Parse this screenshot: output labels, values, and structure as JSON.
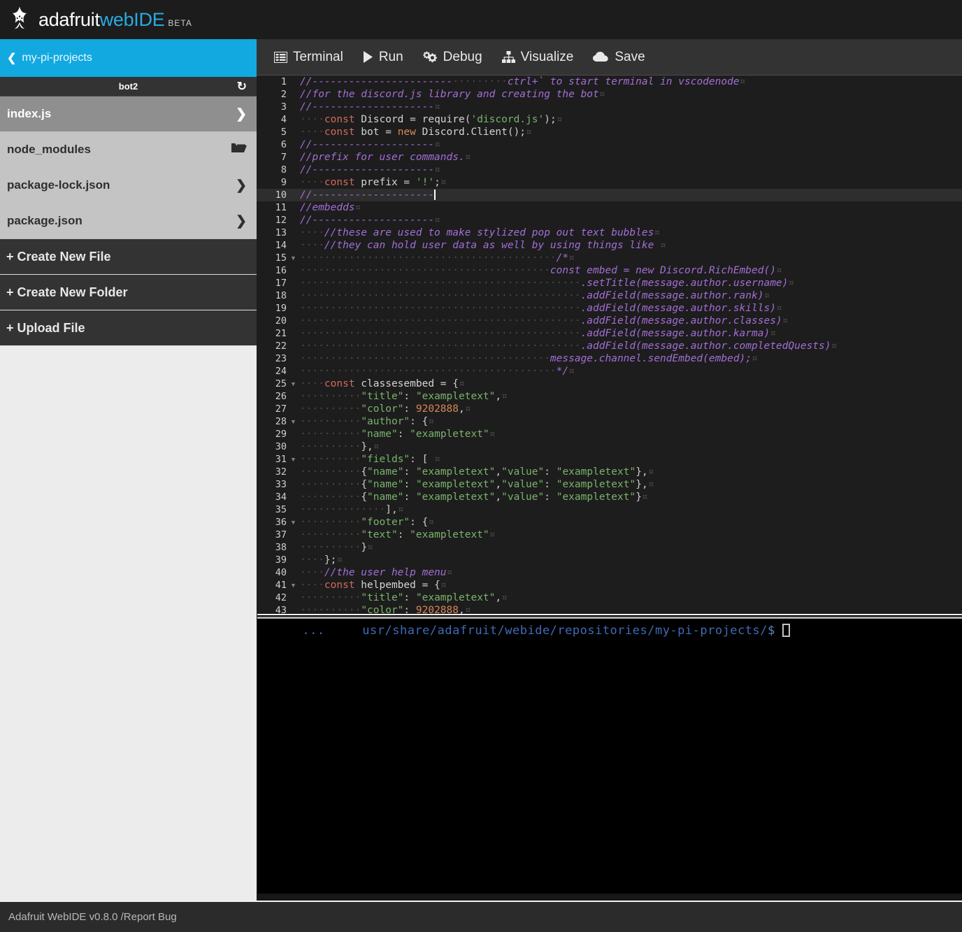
{
  "app": {
    "brand_first": "adafruit",
    "brand_second": "webIDE",
    "brand_badge": "BETA",
    "logo_icon": "adafruit-star-icon"
  },
  "sidebar": {
    "project": {
      "label": "my-pi-projects",
      "back_icon": "chevron-left-icon"
    },
    "folder": {
      "name": "bot2",
      "refresh_icon": "refresh-icon"
    },
    "files": [
      {
        "name": "index.js",
        "icon": "chevron-right-icon",
        "selected": true
      },
      {
        "name": "node_modules",
        "icon": "folder-icon",
        "selected": false
      },
      {
        "name": "package-lock.json",
        "icon": "chevron-right-icon",
        "selected": false
      },
      {
        "name": "package.json",
        "icon": "chevron-right-icon",
        "selected": false
      }
    ],
    "actions": [
      {
        "label": "+ Create New File"
      },
      {
        "label": "+ Create New Folder"
      },
      {
        "label": "+ Upload File"
      }
    ]
  },
  "toolbar": {
    "buttons": [
      {
        "label": "Terminal",
        "icon": "terminal-list-icon"
      },
      {
        "label": "Run",
        "icon": "play-icon"
      },
      {
        "label": "Debug",
        "icon": "gears-icon"
      },
      {
        "label": "Visualize",
        "icon": "sitemap-icon"
      },
      {
        "label": "Save",
        "icon": "cloud-icon"
      }
    ]
  },
  "editor": {
    "active_line": 10,
    "lines": [
      {
        "n": 1,
        "fold": false,
        "tokens": [
          {
            "t": "com",
            "v": "//-----------------------"
          },
          {
            "t": "ws",
            "v": "·········"
          },
          {
            "t": "com",
            "v": "ctrl+` to start terminal in vscodenode"
          },
          {
            "t": "eol",
            "v": "¤"
          }
        ]
      },
      {
        "n": 2,
        "fold": false,
        "tokens": [
          {
            "t": "com",
            "v": "//for the discord.js library and creating the bot"
          },
          {
            "t": "eol",
            "v": "¤"
          }
        ]
      },
      {
        "n": 3,
        "fold": false,
        "tokens": [
          {
            "t": "com",
            "v": "//--------------------"
          },
          {
            "t": "eol",
            "v": "¤"
          }
        ]
      },
      {
        "n": 4,
        "fold": false,
        "tokens": [
          {
            "t": "ws",
            "v": "····"
          },
          {
            "t": "kw",
            "v": "const"
          },
          {
            "t": "id",
            "v": " Discord "
          },
          {
            "t": "pun",
            "v": "="
          },
          {
            "t": "id",
            "v": " require"
          },
          {
            "t": "pun",
            "v": "("
          },
          {
            "t": "str",
            "v": "'discord.js'"
          },
          {
            "t": "pun",
            "v": ");"
          },
          {
            "t": "eol",
            "v": "¤"
          }
        ]
      },
      {
        "n": 5,
        "fold": false,
        "tokens": [
          {
            "t": "ws",
            "v": "····"
          },
          {
            "t": "kw",
            "v": "const"
          },
          {
            "t": "id",
            "v": " bot "
          },
          {
            "t": "pun",
            "v": "="
          },
          {
            "t": "kw2",
            "v": " new"
          },
          {
            "t": "id",
            "v": " Discord.Client"
          },
          {
            "t": "pun",
            "v": "();"
          },
          {
            "t": "eol",
            "v": "¤"
          }
        ]
      },
      {
        "n": 6,
        "fold": false,
        "tokens": [
          {
            "t": "com",
            "v": "//--------------------"
          },
          {
            "t": "eol",
            "v": "¤"
          }
        ]
      },
      {
        "n": 7,
        "fold": false,
        "tokens": [
          {
            "t": "com",
            "v": "//prefix for user commands."
          },
          {
            "t": "eol",
            "v": "¤"
          }
        ]
      },
      {
        "n": 8,
        "fold": false,
        "tokens": [
          {
            "t": "com",
            "v": "//--------------------"
          },
          {
            "t": "eol",
            "v": "¤"
          }
        ]
      },
      {
        "n": 9,
        "fold": false,
        "tokens": [
          {
            "t": "ws",
            "v": "····"
          },
          {
            "t": "kw",
            "v": "const"
          },
          {
            "t": "id",
            "v": " prefix "
          },
          {
            "t": "pun",
            "v": "="
          },
          {
            "t": "str",
            "v": " '!'"
          },
          {
            "t": "pun",
            "v": ";"
          },
          {
            "t": "eol",
            "v": "¤"
          }
        ]
      },
      {
        "n": 10,
        "fold": false,
        "tokens": [
          {
            "t": "com",
            "v": "//--------------------"
          },
          {
            "t": "caret",
            "v": ""
          }
        ]
      },
      {
        "n": 11,
        "fold": false,
        "tokens": [
          {
            "t": "com",
            "v": "//embedds"
          },
          {
            "t": "eol",
            "v": "¤"
          }
        ]
      },
      {
        "n": 12,
        "fold": false,
        "tokens": [
          {
            "t": "com",
            "v": "//--------------------"
          },
          {
            "t": "eol",
            "v": "¤"
          }
        ]
      },
      {
        "n": 13,
        "fold": false,
        "tokens": [
          {
            "t": "ws",
            "v": "····"
          },
          {
            "t": "com",
            "v": "//these are used to make stylized pop out text bubbles"
          },
          {
            "t": "eol",
            "v": "¤"
          }
        ]
      },
      {
        "n": 14,
        "fold": false,
        "tokens": [
          {
            "t": "ws",
            "v": "····"
          },
          {
            "t": "com",
            "v": "//they can hold user data as well by using things like "
          },
          {
            "t": "eol",
            "v": "¤"
          }
        ]
      },
      {
        "n": 15,
        "fold": true,
        "tokens": [
          {
            "t": "ws",
            "v": "··········································"
          },
          {
            "t": "com",
            "v": "/*"
          },
          {
            "t": "eol",
            "v": "¤"
          }
        ]
      },
      {
        "n": 16,
        "fold": false,
        "tokens": [
          {
            "t": "ws",
            "v": "·········································"
          },
          {
            "t": "com",
            "v": "const embed = new Discord.RichEmbed()"
          },
          {
            "t": "eol",
            "v": "¤"
          }
        ]
      },
      {
        "n": 17,
        "fold": false,
        "tokens": [
          {
            "t": "ws",
            "v": "··············································"
          },
          {
            "t": "com",
            "v": ".setTitle(message.author.username)"
          },
          {
            "t": "eol",
            "v": "¤"
          }
        ]
      },
      {
        "n": 18,
        "fold": false,
        "tokens": [
          {
            "t": "ws",
            "v": "··············································"
          },
          {
            "t": "com",
            "v": ".addField(message.author.rank)"
          },
          {
            "t": "eol",
            "v": "¤"
          }
        ]
      },
      {
        "n": 19,
        "fold": false,
        "tokens": [
          {
            "t": "ws",
            "v": "··············································"
          },
          {
            "t": "com",
            "v": ".addField(message.author.skills)"
          },
          {
            "t": "eol",
            "v": "¤"
          }
        ]
      },
      {
        "n": 20,
        "fold": false,
        "tokens": [
          {
            "t": "ws",
            "v": "··············································"
          },
          {
            "t": "com",
            "v": ".addField(message.author.classes)"
          },
          {
            "t": "eol",
            "v": "¤"
          }
        ]
      },
      {
        "n": 21,
        "fold": false,
        "tokens": [
          {
            "t": "ws",
            "v": "··············································"
          },
          {
            "t": "com",
            "v": ".addField(message.author.karma)"
          },
          {
            "t": "eol",
            "v": "¤"
          }
        ]
      },
      {
        "n": 22,
        "fold": false,
        "tokens": [
          {
            "t": "ws",
            "v": "··············································"
          },
          {
            "t": "com",
            "v": ".addField(message.author.completedQuests)"
          },
          {
            "t": "eol",
            "v": "¤"
          }
        ]
      },
      {
        "n": 23,
        "fold": false,
        "tokens": [
          {
            "t": "ws",
            "v": "·········································"
          },
          {
            "t": "com",
            "v": "message.channel.sendEmbed(embed);"
          },
          {
            "t": "eol",
            "v": "¤"
          }
        ]
      },
      {
        "n": 24,
        "fold": false,
        "tokens": [
          {
            "t": "ws",
            "v": "··········································"
          },
          {
            "t": "com",
            "v": "*/"
          },
          {
            "t": "eol",
            "v": "¤"
          }
        ]
      },
      {
        "n": 25,
        "fold": true,
        "tokens": [
          {
            "t": "ws",
            "v": "····"
          },
          {
            "t": "kw",
            "v": "const"
          },
          {
            "t": "id",
            "v": " classesembed "
          },
          {
            "t": "pun",
            "v": "= {"
          },
          {
            "t": "eol",
            "v": "¤"
          }
        ]
      },
      {
        "n": 26,
        "fold": false,
        "tokens": [
          {
            "t": "ws",
            "v": "··········"
          },
          {
            "t": "str",
            "v": "\"title\""
          },
          {
            "t": "pun",
            "v": ": "
          },
          {
            "t": "str",
            "v": "\"exampletext\""
          },
          {
            "t": "pun",
            "v": ","
          },
          {
            "t": "eol",
            "v": "¤"
          }
        ]
      },
      {
        "n": 27,
        "fold": false,
        "tokens": [
          {
            "t": "ws",
            "v": "··········"
          },
          {
            "t": "str",
            "v": "\"color\""
          },
          {
            "t": "pun",
            "v": ": "
          },
          {
            "t": "num",
            "v": "9202888"
          },
          {
            "t": "pun",
            "v": ","
          },
          {
            "t": "eol",
            "v": "¤"
          }
        ]
      },
      {
        "n": 28,
        "fold": true,
        "tokens": [
          {
            "t": "ws",
            "v": "··········"
          },
          {
            "t": "str",
            "v": "\"author\""
          },
          {
            "t": "pun",
            "v": ": {"
          },
          {
            "t": "eol",
            "v": "¤"
          }
        ]
      },
      {
        "n": 29,
        "fold": false,
        "tokens": [
          {
            "t": "ws",
            "v": "··········"
          },
          {
            "t": "str",
            "v": "\"name\""
          },
          {
            "t": "pun",
            "v": ": "
          },
          {
            "t": "str",
            "v": "\"exampletext\""
          },
          {
            "t": "eol",
            "v": "¤"
          }
        ]
      },
      {
        "n": 30,
        "fold": false,
        "tokens": [
          {
            "t": "ws",
            "v": "··········"
          },
          {
            "t": "pun",
            "v": "},"
          },
          {
            "t": "eol",
            "v": "¤"
          }
        ]
      },
      {
        "n": 31,
        "fold": true,
        "tokens": [
          {
            "t": "ws",
            "v": "··········"
          },
          {
            "t": "str",
            "v": "\"fields\""
          },
          {
            "t": "pun",
            "v": ": ["
          },
          {
            "t": "eol",
            "v": " ¤"
          }
        ]
      },
      {
        "n": 32,
        "fold": false,
        "tokens": [
          {
            "t": "ws",
            "v": "··········"
          },
          {
            "t": "pun",
            "v": "{"
          },
          {
            "t": "str",
            "v": "\"name\""
          },
          {
            "t": "pun",
            "v": ": "
          },
          {
            "t": "str",
            "v": "\"exampletext\""
          },
          {
            "t": "pun",
            "v": ","
          },
          {
            "t": "str",
            "v": "\"value\""
          },
          {
            "t": "pun",
            "v": ": "
          },
          {
            "t": "str",
            "v": "\"exampletext\""
          },
          {
            "t": "pun",
            "v": "},"
          },
          {
            "t": "eol",
            "v": "¤"
          }
        ]
      },
      {
        "n": 33,
        "fold": false,
        "tokens": [
          {
            "t": "ws",
            "v": "··········"
          },
          {
            "t": "pun",
            "v": "{"
          },
          {
            "t": "str",
            "v": "\"name\""
          },
          {
            "t": "pun",
            "v": ": "
          },
          {
            "t": "str",
            "v": "\"exampletext\""
          },
          {
            "t": "pun",
            "v": ","
          },
          {
            "t": "str",
            "v": "\"value\""
          },
          {
            "t": "pun",
            "v": ": "
          },
          {
            "t": "str",
            "v": "\"exampletext\""
          },
          {
            "t": "pun",
            "v": "},"
          },
          {
            "t": "eol",
            "v": "¤"
          }
        ]
      },
      {
        "n": 34,
        "fold": false,
        "tokens": [
          {
            "t": "ws",
            "v": "··········"
          },
          {
            "t": "pun",
            "v": "{"
          },
          {
            "t": "str",
            "v": "\"name\""
          },
          {
            "t": "pun",
            "v": ": "
          },
          {
            "t": "str",
            "v": "\"exampletext\""
          },
          {
            "t": "pun",
            "v": ","
          },
          {
            "t": "str",
            "v": "\"value\""
          },
          {
            "t": "pun",
            "v": ": "
          },
          {
            "t": "str",
            "v": "\"exampletext\""
          },
          {
            "t": "pun",
            "v": "}"
          },
          {
            "t": "eol",
            "v": "¤"
          }
        ]
      },
      {
        "n": 35,
        "fold": false,
        "tokens": [
          {
            "t": "ws",
            "v": "··············"
          },
          {
            "t": "pun",
            "v": "],"
          },
          {
            "t": "eol",
            "v": "¤"
          }
        ]
      },
      {
        "n": 36,
        "fold": true,
        "tokens": [
          {
            "t": "ws",
            "v": "··········"
          },
          {
            "t": "str",
            "v": "\"footer\""
          },
          {
            "t": "pun",
            "v": ": {"
          },
          {
            "t": "eol",
            "v": "¤"
          }
        ]
      },
      {
        "n": 37,
        "fold": false,
        "tokens": [
          {
            "t": "ws",
            "v": "··········"
          },
          {
            "t": "str",
            "v": "\"text\""
          },
          {
            "t": "pun",
            "v": ": "
          },
          {
            "t": "str",
            "v": "\"exampletext\""
          },
          {
            "t": "eol",
            "v": "¤"
          }
        ]
      },
      {
        "n": 38,
        "fold": false,
        "tokens": [
          {
            "t": "ws",
            "v": "··········"
          },
          {
            "t": "pun",
            "v": "}"
          },
          {
            "t": "eol",
            "v": "¤"
          }
        ]
      },
      {
        "n": 39,
        "fold": false,
        "tokens": [
          {
            "t": "ws",
            "v": "····"
          },
          {
            "t": "pun",
            "v": "};"
          },
          {
            "t": "eol",
            "v": "¤"
          }
        ]
      },
      {
        "n": 40,
        "fold": false,
        "tokens": [
          {
            "t": "ws",
            "v": "····"
          },
          {
            "t": "com",
            "v": "//the user help menu"
          },
          {
            "t": "eol",
            "v": "¤"
          }
        ]
      },
      {
        "n": 41,
        "fold": true,
        "tokens": [
          {
            "t": "ws",
            "v": "····"
          },
          {
            "t": "kw",
            "v": "const"
          },
          {
            "t": "id",
            "v": " helpembed "
          },
          {
            "t": "pun",
            "v": "= {"
          },
          {
            "t": "eol",
            "v": "¤"
          }
        ]
      },
      {
        "n": 42,
        "fold": false,
        "tokens": [
          {
            "t": "ws",
            "v": "··········"
          },
          {
            "t": "str",
            "v": "\"title\""
          },
          {
            "t": "pun",
            "v": ": "
          },
          {
            "t": "str",
            "v": "\"exampletext\""
          },
          {
            "t": "pun",
            "v": ","
          },
          {
            "t": "eol",
            "v": "¤"
          }
        ]
      },
      {
        "n": 43,
        "fold": false,
        "tokens": [
          {
            "t": "ws",
            "v": "··········"
          },
          {
            "t": "str",
            "v": "\"color\""
          },
          {
            "t": "pun",
            "v": ": "
          },
          {
            "t": "num",
            "v": "9202888"
          },
          {
            "t": "pun",
            "v": ","
          },
          {
            "t": "eol",
            "v": "¤"
          }
        ]
      }
    ]
  },
  "terminal": {
    "prompt": "  ...     usr/share/adafruit/webide/repositories/my-pi-projects/",
    "symbol": "$",
    "cursor": "block-cursor"
  },
  "footer": {
    "text": "Adafruit WebIDE v0.8.0 /Report Bug"
  }
}
